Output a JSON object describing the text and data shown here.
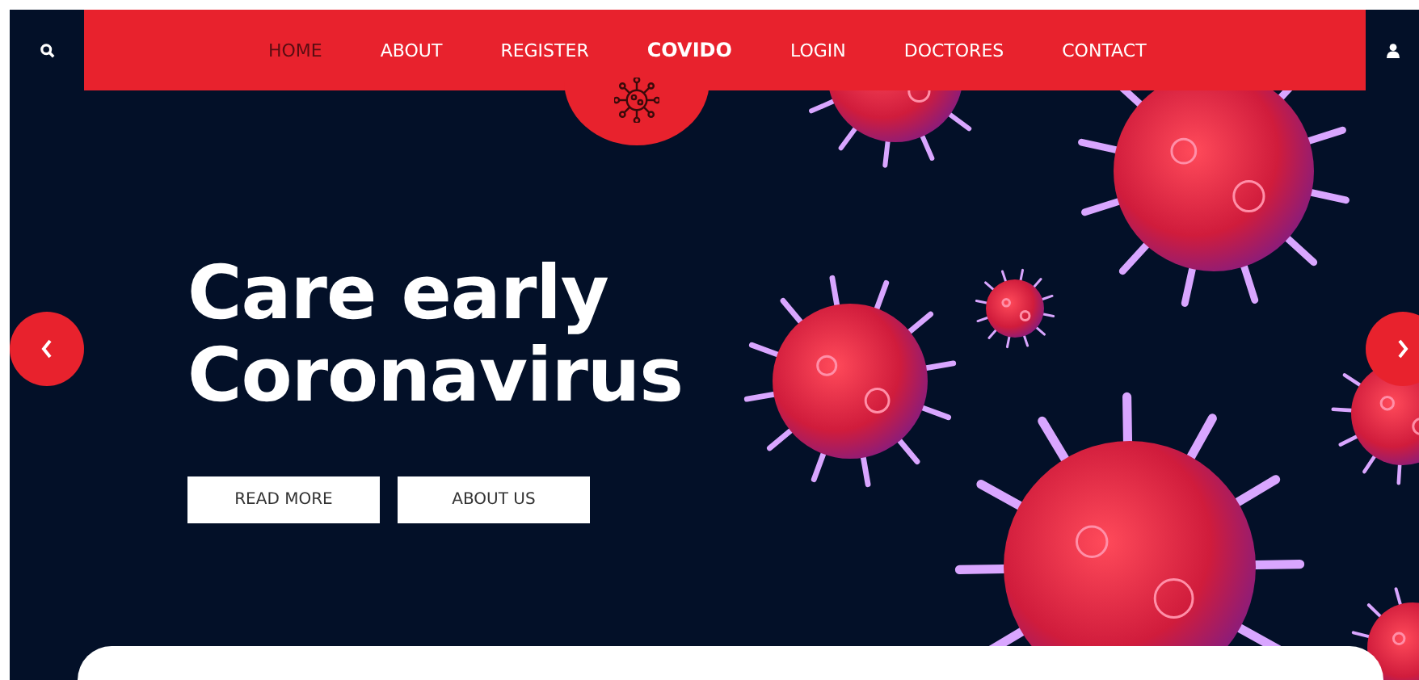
{
  "nav": {
    "items": [
      {
        "label": "HOME",
        "kind": "link",
        "selected": true
      },
      {
        "label": "ABOUT",
        "kind": "link",
        "selected": false
      },
      {
        "label": "REGISTER",
        "kind": "link",
        "selected": false
      },
      {
        "label": "COVIDO",
        "kind": "brand",
        "selected": false
      },
      {
        "label": "LOGIN",
        "kind": "link",
        "selected": false
      },
      {
        "label": "DOCTORES",
        "kind": "link",
        "selected": false
      },
      {
        "label": "CONTACT",
        "kind": "link",
        "selected": false
      }
    ]
  },
  "hero": {
    "headline": [
      "Care early",
      "Coronavirus"
    ],
    "buttons": [
      "READ MORE",
      "ABOUT US"
    ]
  }
}
